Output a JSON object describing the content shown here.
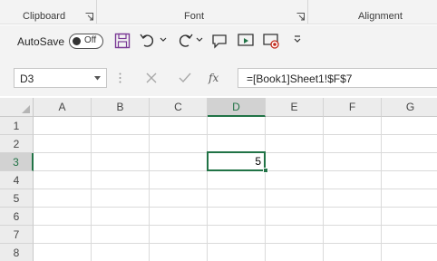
{
  "ribbon": {
    "groups": [
      {
        "label": "Clipboard"
      },
      {
        "label": "Font"
      },
      {
        "label": "Alignment"
      }
    ]
  },
  "qat": {
    "autosave_label": "AutoSave",
    "autosave_state": "Off",
    "buttons": [
      "save-icon",
      "undo-icon",
      "redo-icon",
      "comment-icon",
      "present-icon",
      "record-icon",
      "customize-icon"
    ]
  },
  "formula_bar": {
    "name_box": "D3",
    "formula": "=[Book1]Sheet1!$F$7",
    "fx_label": "fx"
  },
  "grid": {
    "columns": [
      "A",
      "B",
      "C",
      "D",
      "E",
      "F",
      "G"
    ],
    "rows": [
      "1",
      "2",
      "3",
      "4",
      "5",
      "6",
      "7",
      "8"
    ],
    "selected_column": "D",
    "selected_row": "3",
    "active_cell_value": "5"
  },
  "colors": {
    "accent": "#217346",
    "ribbon_bg": "#f3f3f3",
    "save_icon": "#7b3a96"
  }
}
